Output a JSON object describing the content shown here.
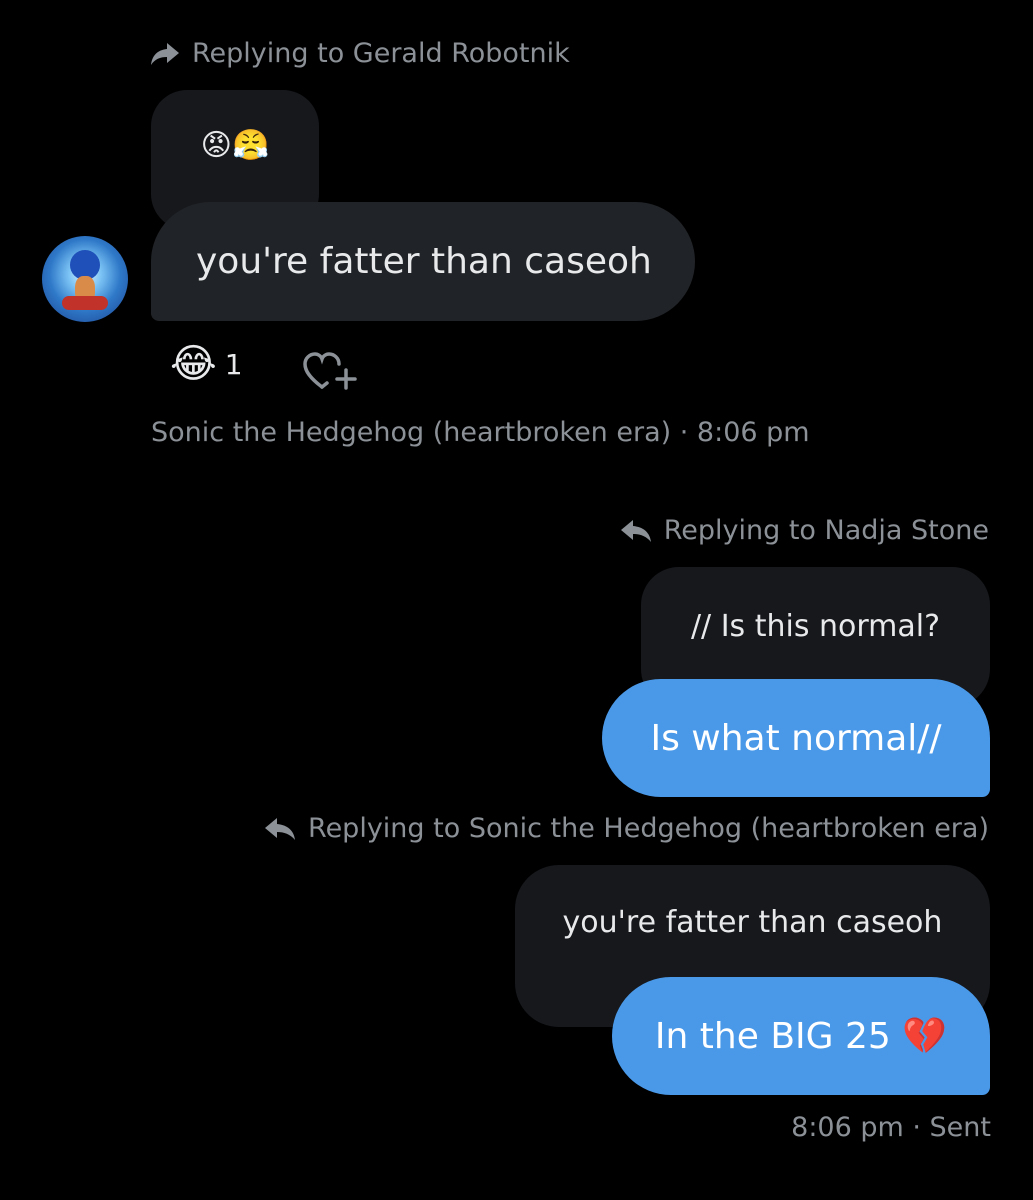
{
  "messages": [
    {
      "reply_context": "Replying to Gerald Robotnik",
      "quoted_text": "😡😤",
      "text": "you're fatter than caseoh",
      "reaction": {
        "emoji": "😂",
        "count": "1"
      },
      "meta": "Sonic the Hedgehog (heartbroken era) · 8:06 pm"
    },
    {
      "reply_context": "Replying to Nadja Stone",
      "quoted_text": "// Is this normal?",
      "text": "Is what normal//"
    },
    {
      "reply_context": "Replying to Sonic the Hedgehog (heartbroken era)",
      "quoted_text": "you're fatter than caseoh",
      "text": "In the BIG 25 💔",
      "meta": "8:06 pm · Sent"
    }
  ],
  "icons": {
    "forward": "forward-arrow-icon",
    "reply": "reply-arrow-icon",
    "add_reaction": "heart-plus-icon",
    "avatar": "sonic-avatar"
  },
  "colors": {
    "background": "#000000",
    "bubble_dark": "#202327",
    "bubble_blue": "#4a99e9",
    "muted": "#8b9197"
  }
}
